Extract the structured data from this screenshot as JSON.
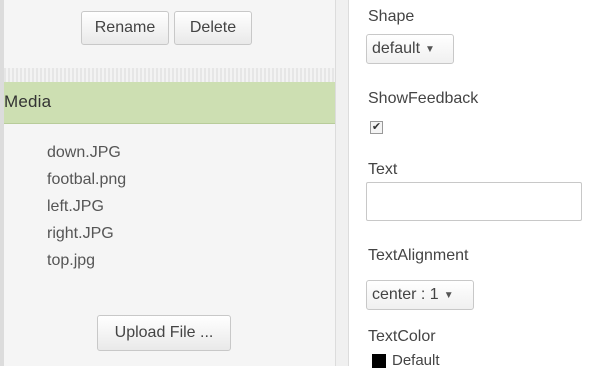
{
  "assets_panel": {
    "rename_label": "Rename",
    "delete_label": "Delete",
    "media_title": "Media",
    "media_items": [
      "down.JPG",
      "footbal.png",
      "left.JPG",
      "right.JPG",
      "top.jpg"
    ],
    "upload_label": "Upload File ..."
  },
  "properties": {
    "shape_label": "Shape",
    "shape_value": "default",
    "showfeedback_label": "ShowFeedback",
    "showfeedback_checked": true,
    "text_label": "Text",
    "text_value": "",
    "textalignment_label": "TextAlignment",
    "textalignment_value": "center : 1",
    "textcolor_label": "TextColor",
    "textcolor_value": "Default"
  },
  "colors": {
    "media_header": "#cddfb2",
    "panel_bg": "#f5f5f5",
    "swatch": "#000000"
  }
}
